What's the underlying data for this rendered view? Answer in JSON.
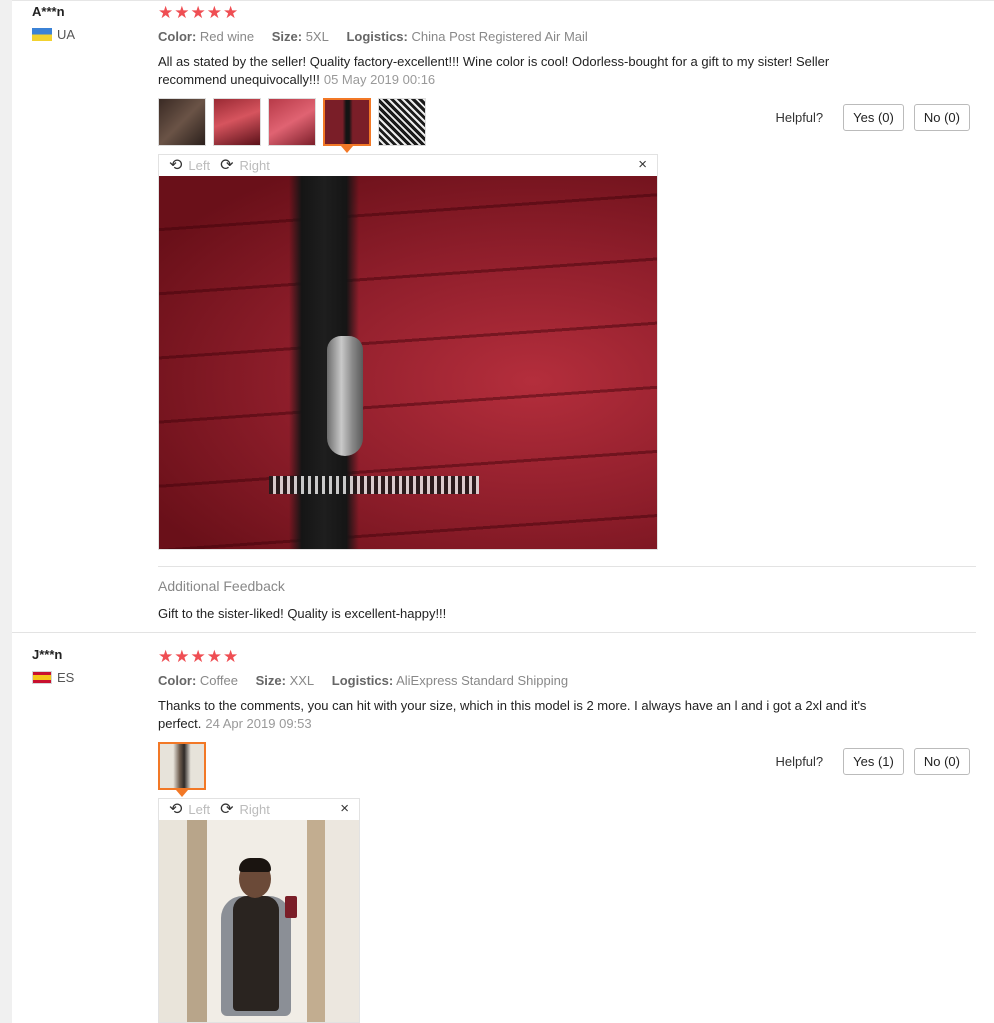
{
  "reviews": [
    {
      "username": "A***n",
      "country": "UA",
      "stars": "★★★★★",
      "attributes": {
        "color_label": "Color:",
        "color_value": "Red wine",
        "size_label": "Size:",
        "size_value": "5XL",
        "logistics_label": "Logistics:",
        "logistics_value": "China Post Registered Air Mail"
      },
      "text": "All as stated by the seller! Quality factory-excellent!!! Wine color is cool! Odorless-bought for a gift to my sister! Seller recommend unequivocally!!!",
      "date": "05 May 2019 00:16",
      "helpful_label": "Helpful?",
      "yes_label": "Yes (0)",
      "no_label": "No (0)",
      "viewer": {
        "left_label": "Left",
        "right_label": "Right",
        "close_glyph": "×"
      },
      "additional_feedback_title": "Additional Feedback",
      "additional_feedback_text": "Gift to the sister-liked! Quality is excellent-happy!!!"
    },
    {
      "username": "J***n",
      "country": "ES",
      "stars": "★★★★★",
      "attributes": {
        "color_label": "Color:",
        "color_value": "Coffee",
        "size_label": "Size:",
        "size_value": "XXL",
        "logistics_label": "Logistics:",
        "logistics_value": "AliExpress Standard Shipping"
      },
      "text": "Thanks to the comments, you can hit with your size, which in this model is 2 more. I always have an l and i got a 2xl and it's perfect.",
      "date": "24 Apr 2019 09:53",
      "helpful_label": "Helpful?",
      "yes_label": "Yes (1)",
      "no_label": "No (0)",
      "viewer": {
        "left_label": "Left",
        "right_label": "Right",
        "close_glyph": "×"
      }
    }
  ],
  "icons": {
    "rotate_left": "rotate-left-icon",
    "rotate_right": "rotate-right-icon",
    "close": "close-icon"
  },
  "colors": {
    "star": "#ef4e53",
    "active_thumb_border": "#f27826",
    "muted_text": "#888888"
  }
}
